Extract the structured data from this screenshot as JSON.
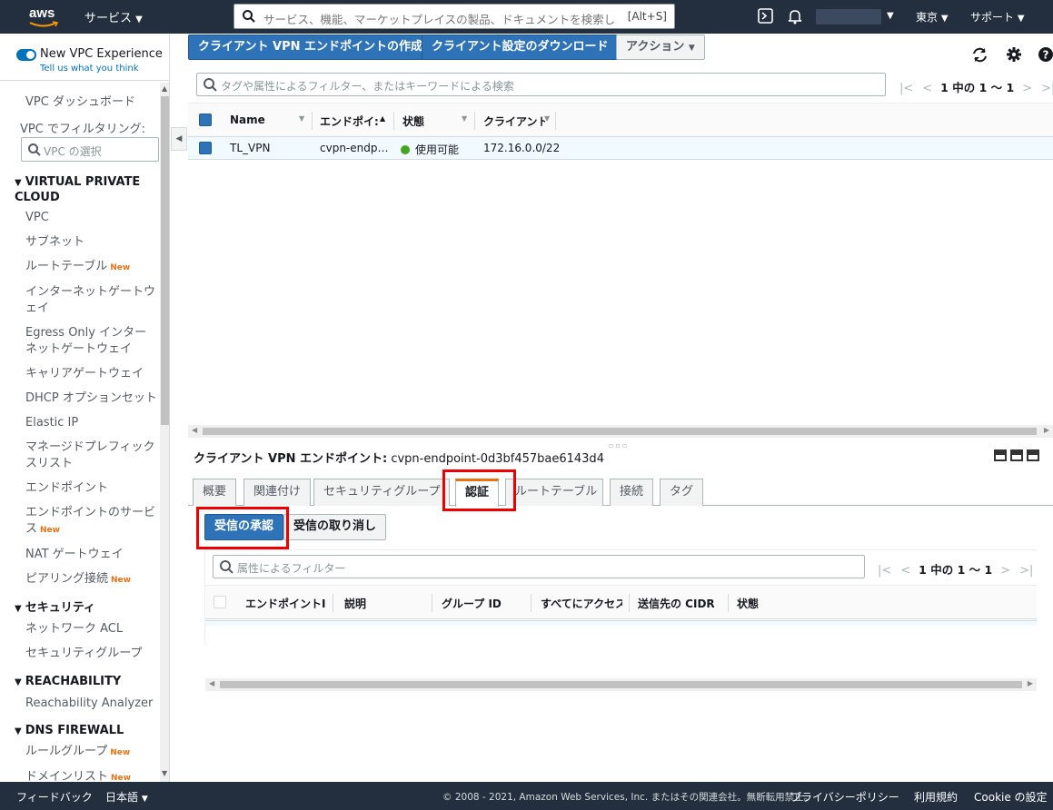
{
  "topbar": {
    "logo_text": "aws",
    "services": "サービス",
    "search_placeholder": "サービス、機能、マーケットプレイスの製品、ドキュメントを検索し",
    "search_shortcut": "[Alt+S]",
    "region": "東京",
    "support": "サポート"
  },
  "sidebar": {
    "new_vpc_experience": "New VPC Experience",
    "tell_us": "Tell us what you think",
    "dashboard": "VPC ダッシュボード",
    "filter_label": "VPC でフィルタリング:",
    "filter_placeholder": "VPC の選択",
    "sections": {
      "vpc": "VIRTUAL PRIVATE CLOUD",
      "security": "セキュリティ",
      "reachability": "REACHABILITY",
      "dns_firewall": "DNS FIREWALL"
    },
    "items": {
      "vpc": "VPC",
      "subnet": "サブネット",
      "route_table": "ルートテーブル",
      "igw": "インターネットゲートウェイ",
      "egress": "Egress Only インターネットゲートウェイ",
      "carrier": "キャリアゲートウェイ",
      "dhcp": "DHCP オプションセット",
      "eip": "Elastic IP",
      "prefix": "マネージドプレフィックスリスト",
      "endpoint": "エンドポイント",
      "endpoint_service": "エンドポイントのサービス",
      "nat": "NAT ゲートウェイ",
      "peering": "ピアリング接続",
      "nacl": "ネットワーク ACL",
      "sg": "セキュリティグループ",
      "reach_analyzer": "Reachability Analyzer",
      "rule_group": "ルールグループ",
      "domain_list": "ドメインリスト"
    },
    "new_badge": "New"
  },
  "toolbar": {
    "create": "クライアント VPN エンドポイントの作成",
    "download": "クライアント設定のダウンロード",
    "actions": "アクション"
  },
  "main": {
    "filter_placeholder": "タグや属性によるフィルター、またはキーワードによる検索",
    "pager": "1 中の 1 〜 1",
    "columns": [
      "Name",
      "エンドポイ:",
      "状態",
      "クライアント"
    ],
    "rows": [
      {
        "name": "TL_VPN",
        "endpoint": "cvpn-endp…",
        "state": "使用可能",
        "client": "172.16.0.0/22"
      }
    ]
  },
  "detail": {
    "label": "クライアント VPN エンドポイント:",
    "endpoint_id": "cvpn-endpoint-0d3bf457bae6143d4",
    "tabs": [
      "概要",
      "関連付け",
      "セキュリティグループ",
      "認証",
      "ルートテーブル",
      "接続",
      "タグ"
    ],
    "active_tab": "認証",
    "authorize_btn": "受信の承認",
    "revoke_btn": "受信の取り消し",
    "filter_placeholder": "属性によるフィルター",
    "pager": "1 中の 1 〜 1",
    "columns": [
      "エンドポイントI",
      "説明",
      "グループ ID",
      "すべてにアクセス",
      "送信先の CIDR",
      "状態"
    ]
  },
  "footer": {
    "feedback": "フィードバック",
    "language": "日本語",
    "copyright": "© 2008 - 2021, Amazon Web Services, Inc. またはその関連会社。無断転用禁止。",
    "privacy": "プライバシーポリシー",
    "terms": "利用規約",
    "cookie": "Cookie の設定"
  }
}
